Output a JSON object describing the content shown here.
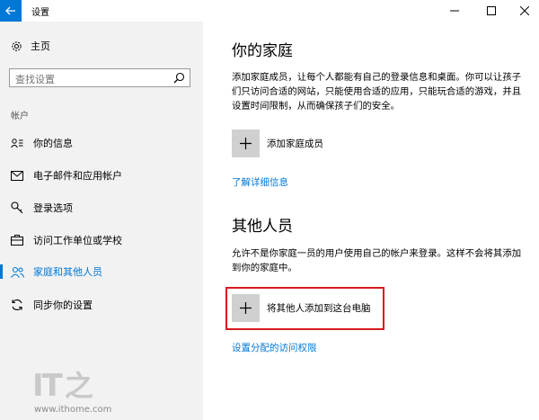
{
  "window": {
    "title": "设置"
  },
  "sidebar": {
    "home_label": "主页",
    "search_placeholder": "查找设置",
    "section_label": "帐户",
    "items": [
      {
        "label": "你的信息",
        "icon": "person-card-icon"
      },
      {
        "label": "电子邮件和应用帐户",
        "icon": "mail-icon"
      },
      {
        "label": "登录选项",
        "icon": "key-icon"
      },
      {
        "label": "访问工作单位或学校",
        "icon": "briefcase-icon"
      },
      {
        "label": "家庭和其他人员",
        "icon": "people-icon",
        "active": true
      },
      {
        "label": "同步你的设置",
        "icon": "sync-icon"
      }
    ]
  },
  "main": {
    "family": {
      "title": "你的家庭",
      "description": "添加家庭成员，让每个人都能有自己的登录信息和桌面。你可以让孩子们只访问合适的网站，只能使用合适的应用，只能玩合适的游戏，并且设置时间限制，从而确保孩子们的安全。",
      "add_label": "添加家庭成员",
      "link": "了解详细信息"
    },
    "others": {
      "title": "其他人员",
      "description": "允许不是你家庭一员的用户使用自己的帐户来登录。这样不会将其添加到你的家庭中。",
      "add_label": "将其他人添加到这台电脑",
      "link": "设置分配的访问权限"
    }
  },
  "watermark": {
    "logo_text": "IT之家",
    "url": "www.ithome.com"
  },
  "colors": {
    "accent": "#0078d7",
    "sidebar_bg": "#f2f2f2",
    "highlight": "#d7191f",
    "plus_box": "#d0d0d0"
  }
}
